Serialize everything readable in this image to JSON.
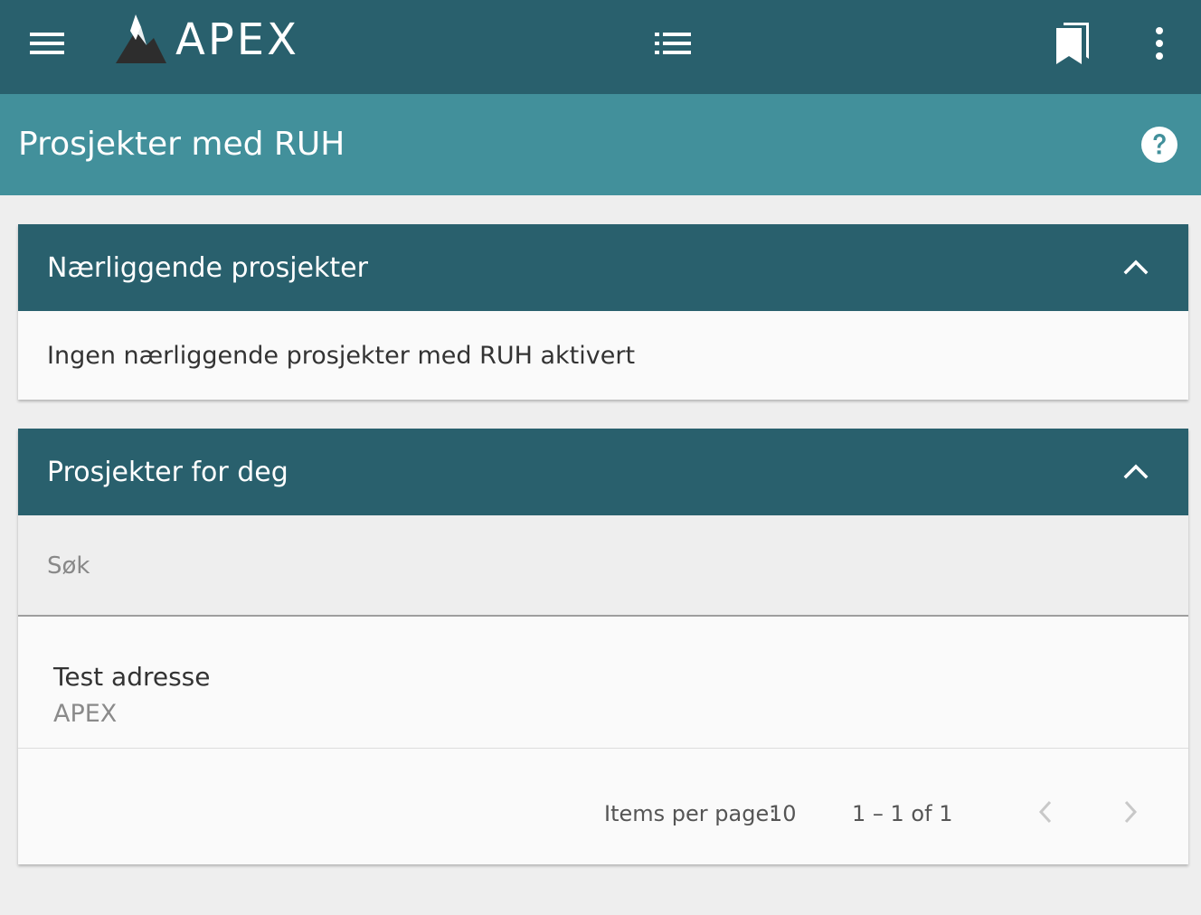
{
  "app": {
    "brand": "APEX",
    "colors": {
      "primary_dark": "#29606d",
      "primary_light": "#42909b",
      "background": "#eeeeee"
    }
  },
  "toolbar": {
    "menu_icon": "hamburger-menu-icon",
    "list_icon": "list-icon",
    "bookmark_icon": "bookmarks-icon",
    "more_icon": "more-vertical-icon"
  },
  "header": {
    "title": "Prosjekter med RUH",
    "help_icon": "help-icon"
  },
  "nearby_section": {
    "title": "Nærliggende prosjekter",
    "empty_message": "Ingen nærliggende prosjekter med RUH aktivert",
    "expanded": true
  },
  "my_projects_section": {
    "title": "Prosjekter for deg",
    "expanded": true,
    "search": {
      "placeholder": "Søk",
      "value": ""
    },
    "items": [
      {
        "title": "Test adresse",
        "subtitle": "APEX"
      }
    ],
    "paginator": {
      "items_per_page_label": "Items per page:",
      "page_size": "10",
      "range_label": "1 – 1 of 1"
    }
  }
}
